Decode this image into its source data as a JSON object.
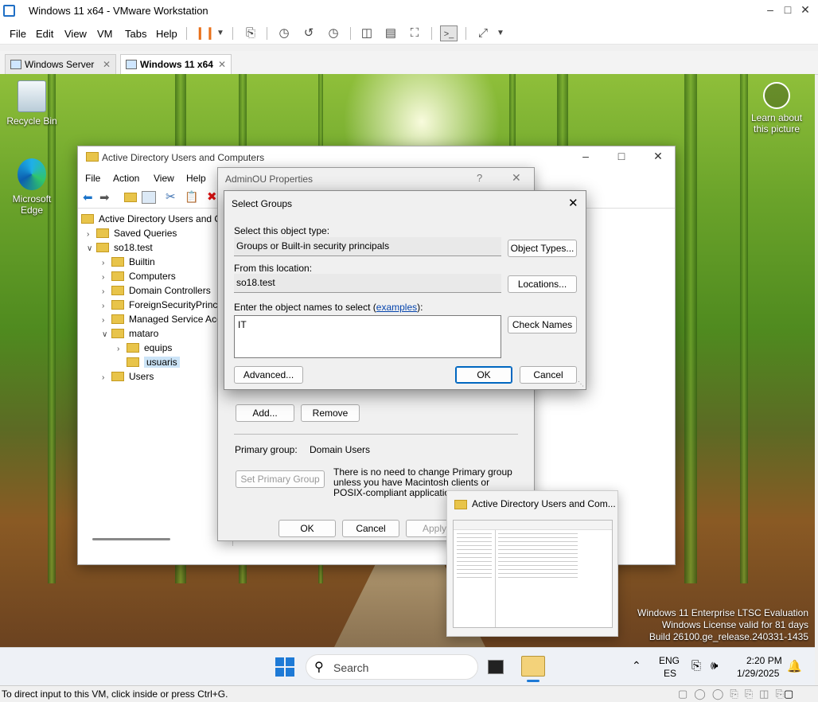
{
  "vmware": {
    "title": "Windows 11 x64 - VMware Workstation",
    "menu": [
      "File",
      "Edit",
      "View",
      "VM",
      "Tabs",
      "Help"
    ],
    "tabs": [
      {
        "label": "Windows Server",
        "active": false
      },
      {
        "label": "Windows 11 x64",
        "active": true
      }
    ],
    "status_hint": "To direct input to this VM, click inside or press Ctrl+G."
  },
  "desktop": {
    "icons": [
      {
        "label": "Recycle Bin"
      },
      {
        "label": "Microsoft Edge"
      },
      {
        "label": "Learn about this picture"
      }
    ],
    "watermark": [
      "Windows 11 Enterprise LTSC Evaluation",
      "Windows License valid for 81 days",
      "Build 26100.ge_release.240331-1435"
    ]
  },
  "aduc": {
    "title": "Active Directory Users and Computers",
    "menu": [
      "File",
      "Action",
      "View",
      "Help"
    ],
    "tree": [
      {
        "label": "Active Directory Users and Co",
        "level": 0,
        "chev": ""
      },
      {
        "label": "Saved Queries",
        "level": 1,
        "chev": ">"
      },
      {
        "label": "so18.test",
        "level": 1,
        "chev": "v"
      },
      {
        "label": "Builtin",
        "level": 2,
        "chev": ">"
      },
      {
        "label": "Computers",
        "level": 2,
        "chev": ">"
      },
      {
        "label": "Domain Controllers",
        "level": 2,
        "chev": ">"
      },
      {
        "label": "ForeignSecurityPrinci",
        "level": 2,
        "chev": ">"
      },
      {
        "label": "Managed Service Acc",
        "level": 2,
        "chev": ">"
      },
      {
        "label": "mataro",
        "level": 2,
        "chev": "v"
      },
      {
        "label": "equips",
        "level": 3,
        "chev": ">"
      },
      {
        "label": "usuaris",
        "level": 3,
        "chev": "",
        "selected": true
      },
      {
        "label": "Users",
        "level": 2,
        "chev": ">"
      }
    ]
  },
  "props": {
    "title": "AdminOU Properties",
    "help": "?",
    "add_label": "Add...",
    "remove_label": "Remove",
    "primary_group_label": "Primary group:",
    "primary_group_value": "Domain Users",
    "set_primary_label": "Set Primary Group",
    "note": "There is no need to change Primary group unless you have Macintosh clients or POSIX-compliant applications.",
    "ok": "OK",
    "cancel": "Cancel",
    "apply": "Apply"
  },
  "select_groups": {
    "title": "Select Groups",
    "object_type_label": "Select this object type:",
    "object_type_value": "Groups or Built-in security principals",
    "object_types_btn": "Object Types...",
    "location_label": "From this location:",
    "location_value": "so18.test",
    "locations_btn": "Locations...",
    "names_label_pre": "Enter the object names to select (",
    "names_label_link": "examples",
    "names_label_post": "):",
    "names_value": "IT",
    "check_names_btn": "Check Names",
    "advanced_btn": "Advanced...",
    "ok_btn": "OK",
    "cancel_btn": "Cancel"
  },
  "thumbnail": {
    "title": "Active Directory Users and Com..."
  },
  "taskbar": {
    "search_placeholder": "Search",
    "lang_top": "ENG",
    "lang_bottom": "ES",
    "time": "2:20 PM",
    "date": "1/29/2025"
  }
}
